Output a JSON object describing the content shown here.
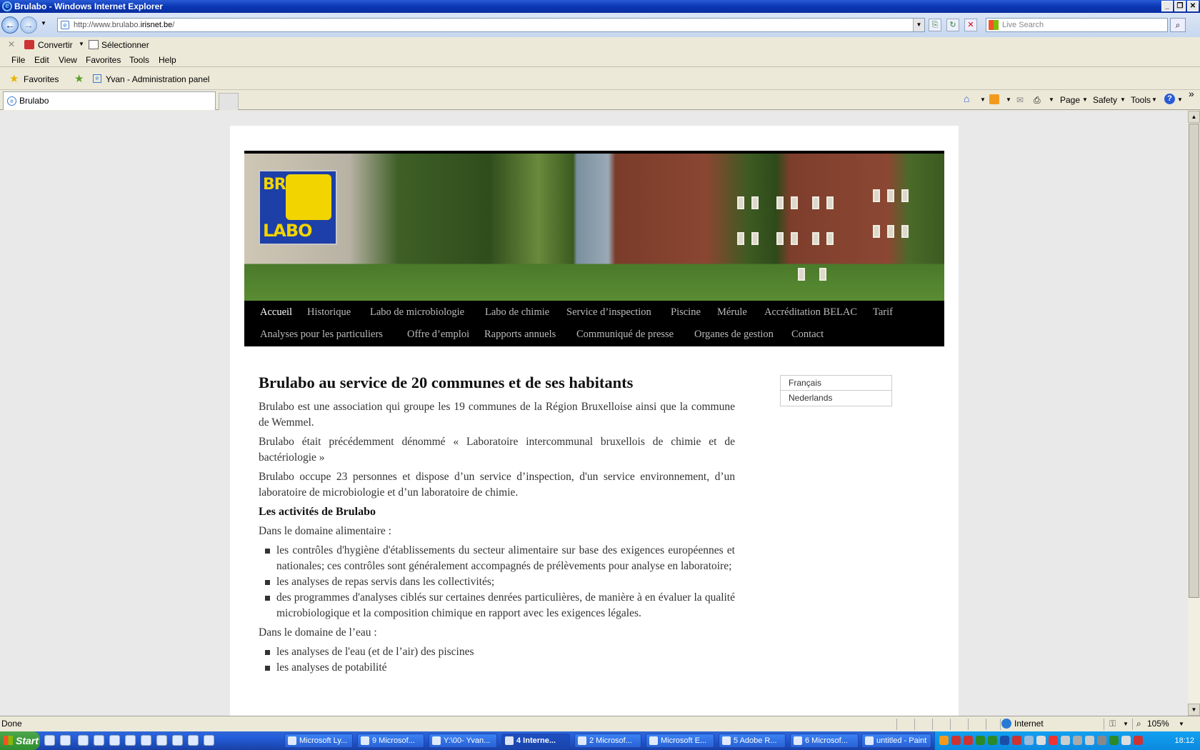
{
  "window": {
    "title": "Brulabo - Windows Internet Explorer"
  },
  "address": {
    "prefix": "http://www.brulabo.",
    "domain": "irisnet.be",
    "suffix": "/"
  },
  "search": {
    "placeholder": "Live Search"
  },
  "toolbar": {
    "convertir": "Convertir",
    "selectionner": "Sélectionner"
  },
  "menu": [
    "File",
    "Edit",
    "View",
    "Favorites",
    "Tools",
    "Help"
  ],
  "favorites": {
    "label": "Favorites",
    "link": "Yvan - Administration panel"
  },
  "tab": {
    "label": "Brulabo"
  },
  "commands": {
    "page": "Page",
    "safety": "Safety",
    "tools": "Tools"
  },
  "site": {
    "logo_lines": [
      "BRU",
      "LABO"
    ],
    "nav_row1": [
      "Accueil",
      "Historique",
      "Labo de microbiologie",
      "Labo de chimie",
      "Service d’inspection",
      "Piscine",
      "Mérule",
      "Accréditation BELAC",
      "Tarif"
    ],
    "nav_row2": [
      "Analyses pour les particuliers",
      "Offre d’emploi",
      "Rapports annuels",
      "Communiqué de presse",
      "Organes de gestion",
      "Contact"
    ],
    "heading": "Brulabo au service de 20 communes et de ses habitants",
    "p1": "Brulabo est une association qui groupe les 19 communes de la Région Bruxelloise ainsi que la commune de Wemmel.",
    "p2": "Brulabo était précédemment dénommé « Laboratoire intercommunal bruxellois de chimie et de bactériologie »",
    "p3": "Brulabo occupe 23 personnes et dispose d’un service d’inspection, d'un service environnement, d’un laboratoire de microbiologie et d’un laboratoire de chimie.",
    "h2": "Les activités  de Brulabo",
    "food_intro": "Dans le domaine alimentaire :",
    "food_items": [
      "les contrôles d'hygiène d'établissements du secteur alimentaire sur base des exigences européennes et nationales; ces contrôles sont généralement accompagnés de prélèvements pour analyse en laboratoire;",
      "les analyses de repas servis dans les collectivités;",
      "des programmes d'analyses ciblés sur certaines denrées particulières, de manière à en évaluer la qualité microbiologique et la composition chimique en rapport avec les exigences légales."
    ],
    "water_intro": "Dans le domaine de l’eau :",
    "water_items": [
      "les analyses de l'eau (et de l’air) des piscines",
      "les analyses de potabilité"
    ],
    "languages": [
      "Français",
      "Nederlands"
    ]
  },
  "status": {
    "text": "Done",
    "zone": "Internet",
    "zoom": "105%"
  },
  "taskbar": {
    "start": "Start",
    "tasks": [
      "Microsoft Ly...",
      "9 Microsof...",
      "Y:\\00- Yvan...",
      "4 Interne...",
      "2 Microsof...",
      "Microsoft E...",
      "5 Adobe R...",
      "6 Microsof...",
      "untitled - Paint"
    ],
    "clock": "18:12"
  }
}
